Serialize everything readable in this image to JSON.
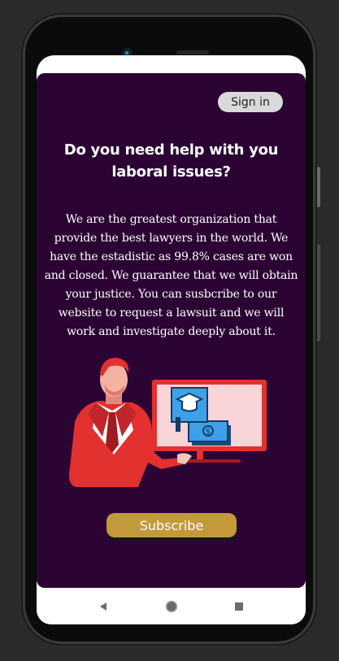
{
  "header": {
    "signin_label": "Sign in"
  },
  "hero": {
    "title": "Do you need help with you laboral issues?",
    "description": "We are the greatest organization that provide the best lawyers in the world. We have the estadistic as 99.8% cases are won and closed. We guarantee that we will obtain your justice. You can susbcribe to our website to request a lawsuit and we will work and investigate deeply about it."
  },
  "cta": {
    "subscribe_label": "Subscribe"
  },
  "illustration": {
    "screen_symbol": "$",
    "icons": [
      "graduation-cap-icon",
      "money-bill-icon"
    ]
  },
  "navigation": {
    "icons": [
      "back-icon",
      "home-icon",
      "recents-icon"
    ]
  },
  "colors": {
    "background": "#2b0433",
    "button_gold": "#c39a3b",
    "signin_gray": "#d9d9d9",
    "suit_red": "#e2312f"
  }
}
